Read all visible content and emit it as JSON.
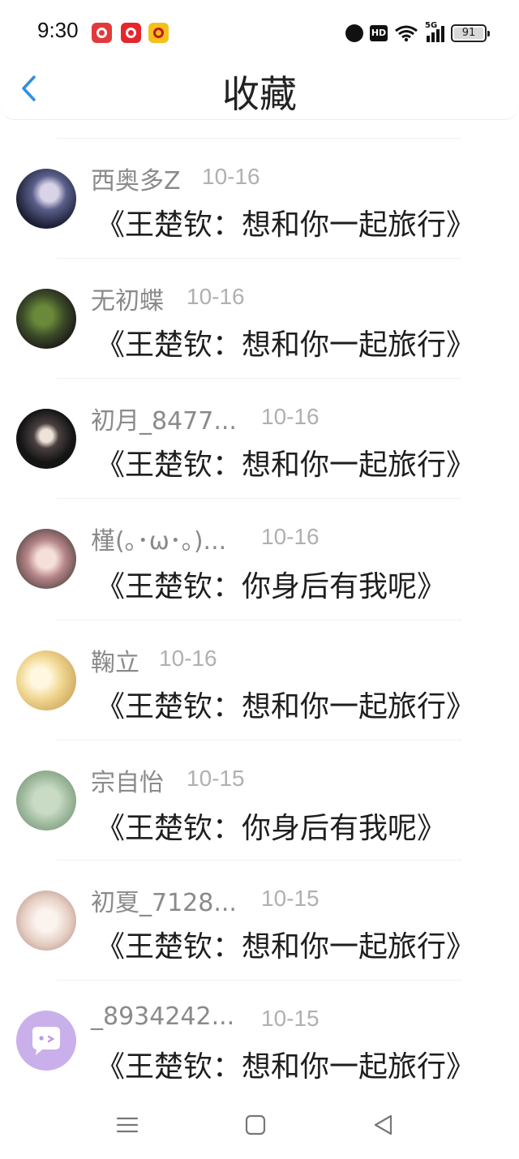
{
  "status_bar": {
    "time": "9:30",
    "apps": [
      "heart-app-icon",
      "netease-music-icon",
      "weibo-icon"
    ],
    "battery": "91"
  },
  "header": {
    "title": "收藏"
  },
  "items": [
    {
      "name": "西奥多Z",
      "date": "10-16",
      "message": "《王楚钦：想和你一起旅行》",
      "avatar_color": "#2b2f4a"
    },
    {
      "name": "无初蝶",
      "date": "10-16",
      "message": "《王楚钦：想和你一起旅行》",
      "avatar_color": "#3b4a2c"
    },
    {
      "name": "初月_8477...",
      "date": "10-16",
      "message": "《王楚钦：想和你一起旅行》",
      "avatar_color": "#1b1b1b"
    },
    {
      "name": "槿(｡･ω･｡)...",
      "date": "10-16",
      "message": "《王楚钦：你身后有我呢》",
      "avatar_color": "#c89f9a"
    },
    {
      "name": "鞠立",
      "date": "10-16",
      "message": "《王楚钦：想和你一起旅行》",
      "avatar_color": "#e9d49a"
    },
    {
      "name": "宗自怡",
      "date": "10-15",
      "message": "《王楚钦：你身后有我呢》",
      "avatar_color": "#9fb79c"
    },
    {
      "name": "初夏_7128...",
      "date": "10-15",
      "message": "《王楚钦：想和你一起旅行》",
      "avatar_color": "#e8d6cf"
    },
    {
      "name": "_8934242...",
      "date": "10-15",
      "message": "《王楚钦：想和你一起旅行》",
      "avatar_color": "#c9b0ea"
    }
  ]
}
